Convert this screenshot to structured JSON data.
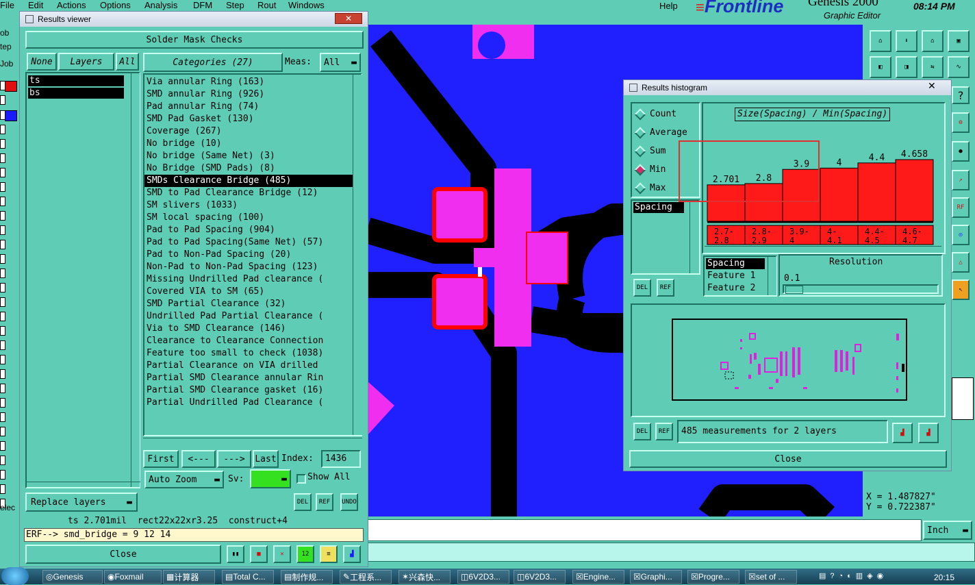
{
  "menu": [
    "File",
    "Edit",
    "Actions",
    "Options",
    "Analysis",
    "DFM",
    "Step",
    "Rout",
    "Windows"
  ],
  "help": "Help",
  "brand": {
    "logo": "Frontline",
    "product": "Genesis 2000",
    "subtitle": "Graphic Editor",
    "time": "08:14 PM"
  },
  "left_strip": [
    "ob",
    "tep",
    "Job",
    "elec"
  ],
  "results_viewer": {
    "title": "Results viewer",
    "close_x": "✕",
    "header": "Solder Mask Checks",
    "layer_buttons": {
      "none": "None",
      "layers": "Layers",
      "all": "All"
    },
    "layers": [
      "ts",
      "bs"
    ],
    "categories_label": "Categories (27)",
    "meas_label": "Meas:",
    "meas_value": "All",
    "categories": [
      "Via annular Ring (163)",
      "SMD annular Ring (926)",
      "Pad annular Ring (74)",
      "SMD Pad Gasket (130)",
      "Coverage (267)",
      "No bridge (10)",
      "No bridge (Same Net) (3)",
      "No Bridge (SMD Pads) (8)",
      "SMDs Clearance Bridge (485)",
      "SMD to Pad Clearance Bridge (12)",
      "SM slivers (1033)",
      "SM local spacing (100)",
      "Pad to Pad Spacing (904)",
      "Pad to Pad Spacing(Same Net) (57)",
      "Pad to Non-Pad Spacing (20)",
      "Non-Pad to Non-Pad Spacing (123)",
      "Missing Undrilled Pad clearance (",
      "Covered VIA to SM (65)",
      "SMD Partial Clearance (32)",
      "Undrilled Pad Partial Clearance (",
      "Via to SMD Clearance (146)",
      "Clearance to Clearance Connection",
      "Feature too small to check (1038)",
      "Partial Clearance on VIA drilled",
      "Partial SMD Clearance annular Rin",
      "Partial SMD Clearance gasket (16)",
      "Partial Undrilled Pad Clearance ("
    ],
    "selected_index": 8,
    "nav": {
      "first": "First",
      "prev": "<---",
      "next": "--->",
      "last": "Last",
      "index_label": "Index:",
      "index_value": "1436"
    },
    "auto_zoom": "Auto Zoom",
    "sv_label": "Sv:",
    "show_all": "Show All",
    "del": "DEL",
    "ref": "REF",
    "undo": "UNDO",
    "replace_layers": "Replace layers",
    "status_line": "ts 2.701mil  rect22x22xr3.25  construct+4",
    "erf_line": "ERF--> smd_bridge = 9 12 14",
    "close": "Close"
  },
  "histogram": {
    "title": "Results histogram",
    "close_x": "✕",
    "modes": [
      "Count",
      "Average",
      "Sum",
      "Min",
      "Max"
    ],
    "selected_mode": "Min",
    "measure_list": [
      "Spacing"
    ],
    "chart_title": "Size(Spacing) / Min(Spacing)",
    "resolution_label": "Resolution",
    "resolution_value": "0.1",
    "attr_list": [
      "Spacing",
      "Feature 1",
      "Feature 2"
    ],
    "summary": "485 measurements for 2 layers",
    "close": "Close",
    "del": "DEL",
    "ref": "REF"
  },
  "chart_data": {
    "type": "bar",
    "title": "Size(Spacing) / Min(Spacing)",
    "categories": [
      [
        "2.7-",
        "2.8"
      ],
      [
        "2.8-",
        "2.9"
      ],
      [
        "3.9-",
        "4"
      ],
      [
        "4-",
        "4.1"
      ],
      [
        "4.4-",
        "4.5"
      ],
      [
        "4.6-",
        "4.7"
      ]
    ],
    "values": [
      2.701,
      2.8,
      3.9,
      4,
      4.4,
      4.658
    ],
    "value_labels": [
      "2.701",
      "2.8",
      "3.9",
      "4",
      "4.4",
      "4.658"
    ]
  },
  "coords": {
    "x": "X = 1.487827\"",
    "y": "Y = 0.722387\""
  },
  "units": "Inch",
  "taskbar": {
    "items": [
      "Genesis",
      "Foxmail",
      "计算器",
      "Total C...",
      "制作规...",
      "工程系...",
      "兴森快...",
      "6V2D3...",
      "6V2D3...",
      "Engine...",
      "Graphi...",
      "Progre...",
      "set of ..."
    ],
    "clock": "20:15"
  },
  "colors": {
    "bg": "#5fcdb5",
    "canvas": "#2020ff",
    "trace": "#000000",
    "pad": "#f02ef0",
    "highlight": "#ff0000"
  }
}
